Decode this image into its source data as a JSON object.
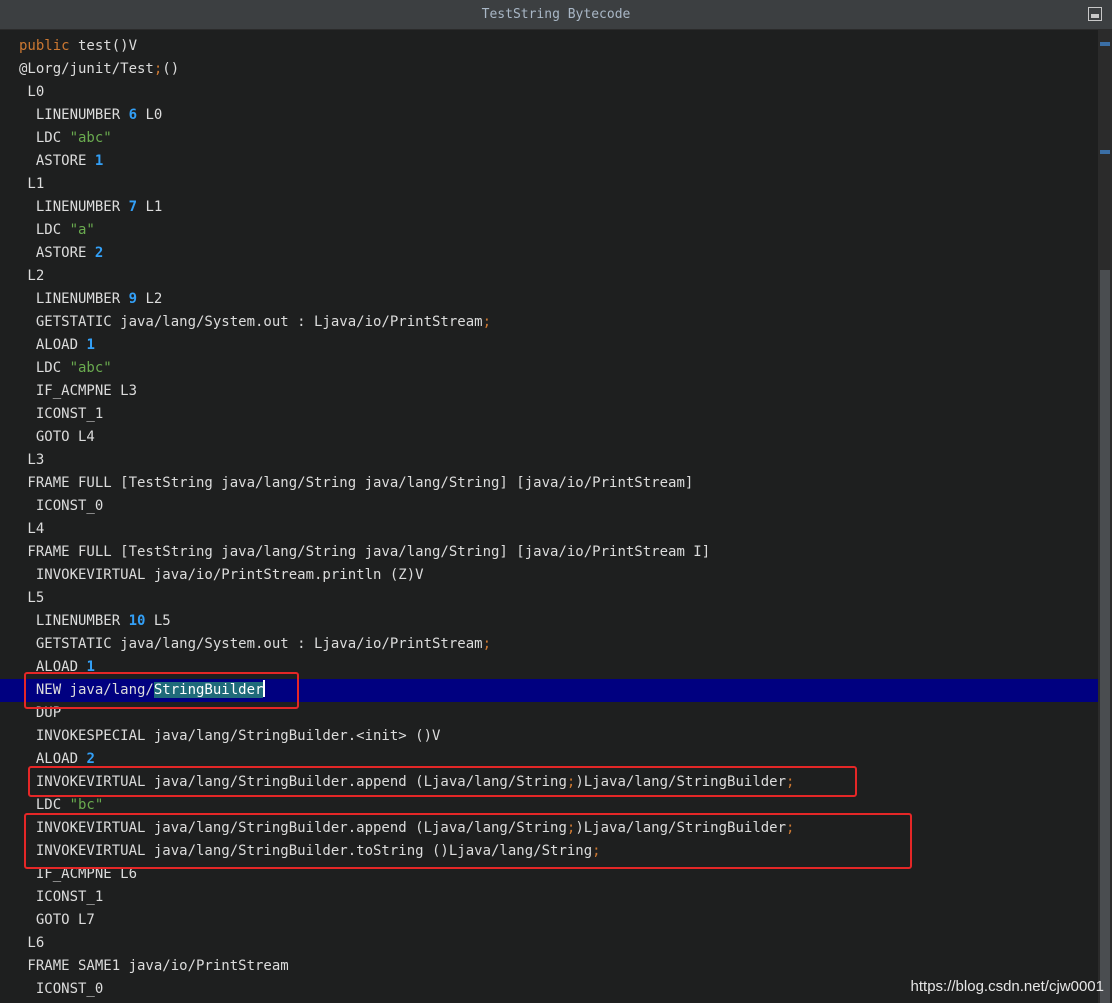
{
  "window": {
    "title": "TestString Bytecode"
  },
  "watermark": "https://blog.csdn.net/cjw0001",
  "colors": {
    "keyword": "#cc7832",
    "number": "#33a0f7",
    "string": "#6aab4f",
    "highlight_line": "#000080",
    "annotation_box": "#e52727"
  },
  "lines": [
    [
      {
        "t": "public",
        "c": "kw"
      },
      {
        "t": " test()V"
      }
    ],
    [
      {
        "t": "@Lorg/junit/Test"
      },
      {
        "t": ";",
        "c": "semi"
      },
      {
        "t": "()"
      }
    ],
    [
      {
        "t": " L0"
      }
    ],
    [
      {
        "t": "  LINENUMBER "
      },
      {
        "t": "6",
        "c": "num"
      },
      {
        "t": " L0"
      }
    ],
    [
      {
        "t": "  LDC "
      },
      {
        "t": "\"abc\"",
        "c": "str"
      }
    ],
    [
      {
        "t": "  ASTORE "
      },
      {
        "t": "1",
        "c": "num"
      }
    ],
    [
      {
        "t": " L1"
      }
    ],
    [
      {
        "t": "  LINENUMBER "
      },
      {
        "t": "7",
        "c": "num"
      },
      {
        "t": " L1"
      }
    ],
    [
      {
        "t": "  LDC "
      },
      {
        "t": "\"a\"",
        "c": "str"
      }
    ],
    [
      {
        "t": "  ASTORE "
      },
      {
        "t": "2",
        "c": "num"
      }
    ],
    [
      {
        "t": " L2"
      }
    ],
    [
      {
        "t": "  LINENUMBER "
      },
      {
        "t": "9",
        "c": "num"
      },
      {
        "t": " L2"
      }
    ],
    [
      {
        "t": "  GETSTATIC java/lang/System.out : Ljava/io/PrintStream"
      },
      {
        "t": ";",
        "c": "semi"
      }
    ],
    [
      {
        "t": "  ALOAD "
      },
      {
        "t": "1",
        "c": "num"
      }
    ],
    [
      {
        "t": "  LDC "
      },
      {
        "t": "\"abc\"",
        "c": "str"
      }
    ],
    [
      {
        "t": "  IF_ACMPNE L3"
      }
    ],
    [
      {
        "t": "  ICONST_1"
      }
    ],
    [
      {
        "t": "  GOTO L4"
      }
    ],
    [
      {
        "t": " L3"
      }
    ],
    [
      {
        "t": " FRAME FULL [TestString java/lang/String java/lang/String] [java/io/PrintStream]"
      }
    ],
    [
      {
        "t": "  ICONST_0"
      }
    ],
    [
      {
        "t": " L4"
      }
    ],
    [
      {
        "t": " FRAME FULL [TestString java/lang/String java/lang/String] [java/io/PrintStream I]"
      }
    ],
    [
      {
        "t": "  INVOKEVIRTUAL java/io/PrintStream.println (Z)V"
      }
    ],
    [
      {
        "t": " L5"
      }
    ],
    [
      {
        "t": "  LINENUMBER "
      },
      {
        "t": "10",
        "c": "num"
      },
      {
        "t": " L5"
      }
    ],
    [
      {
        "t": "  GETSTATIC java/lang/System.out : Ljava/io/PrintStream"
      },
      {
        "t": ";",
        "c": "semi"
      }
    ],
    [
      {
        "t": "  ALOAD "
      },
      {
        "t": "1",
        "c": "num"
      }
    ],
    [
      {
        "t": "  NEW java/lang/"
      },
      {
        "t": "StringBuilder",
        "c": "sel"
      },
      {
        "t": "",
        "c": "caret"
      }
    ],
    [
      {
        "t": "  DUP"
      }
    ],
    [
      {
        "t": "  INVOKESPECIAL java/lang/StringBuilder.<init> ()V"
      }
    ],
    [
      {
        "t": "  ALOAD "
      },
      {
        "t": "2",
        "c": "num"
      }
    ],
    [
      {
        "t": "  INVOKEVIRTUAL java/lang/StringBuilder.append (Ljava/lang/String"
      },
      {
        "t": ";",
        "c": "semi"
      },
      {
        "t": ")Ljava/lang/StringBuilder"
      },
      {
        "t": ";",
        "c": "semi"
      }
    ],
    [
      {
        "t": "  LDC "
      },
      {
        "t": "\"bc\"",
        "c": "str"
      }
    ],
    [
      {
        "t": "  INVOKEVIRTUAL java/lang/StringBuilder.append (Ljava/lang/String"
      },
      {
        "t": ";",
        "c": "semi"
      },
      {
        "t": ")Ljava/lang/StringBuilder"
      },
      {
        "t": ";",
        "c": "semi"
      }
    ],
    [
      {
        "t": "  INVOKEVIRTUAL java/lang/StringBuilder.toString ()Ljava/lang/String"
      },
      {
        "t": ";",
        "c": "semi"
      }
    ],
    [
      {
        "t": "  IF_ACMPNE L6"
      }
    ],
    [
      {
        "t": "  ICONST_1"
      }
    ],
    [
      {
        "t": "  GOTO L7"
      }
    ],
    [
      {
        "t": " L6"
      }
    ],
    [
      {
        "t": " FRAME SAME1 java/io/PrintStream"
      }
    ],
    [
      {
        "t": "  ICONST_0"
      }
    ]
  ]
}
